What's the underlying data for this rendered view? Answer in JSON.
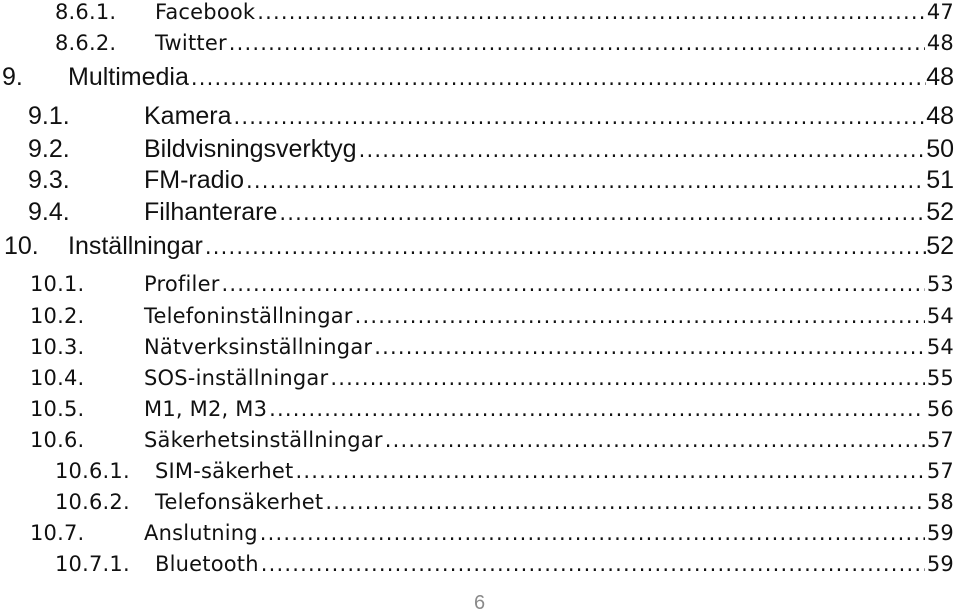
{
  "toc": {
    "entries": [
      {
        "number": "8.6.1.",
        "title": "Facebook",
        "page": "47",
        "level": 3
      },
      {
        "number": "8.6.2.",
        "title": "Twitter",
        "page": "48",
        "level": 3
      },
      {
        "number": "9.",
        "title": "Multimedia",
        "page": "48",
        "level": 1
      },
      {
        "number": "9.1.",
        "title": "Kamera",
        "page": "48",
        "level": 2
      },
      {
        "number": "9.2.",
        "title": "Bildvisningsverktyg",
        "page": "50",
        "level": 2
      },
      {
        "number": "9.3.",
        "title": "FM-radio",
        "page": "51",
        "level": 2
      },
      {
        "number": "9.4.",
        "title": "Filhanterare",
        "page": "52",
        "level": 2
      },
      {
        "number": "10.",
        "title": "Inställningar",
        "page": "52",
        "level": 1
      },
      {
        "number": "10.1.",
        "title": "Profiler",
        "page": "53",
        "level": 2
      },
      {
        "number": "10.2.",
        "title": "Telefoninställningar",
        "page": "54",
        "level": 2
      },
      {
        "number": "10.3.",
        "title": "Nätverksinställningar",
        "page": "54",
        "level": 2
      },
      {
        "number": "10.4.",
        "title": "SOS-inställningar",
        "page": "55",
        "level": 2
      },
      {
        "number": "10.5.",
        "title": "M1, M2, M3",
        "page": "56",
        "level": 2
      },
      {
        "number": "10.6.",
        "title": "Säkerhetsinställningar",
        "page": "57",
        "level": 2
      },
      {
        "number": "10.6.1.",
        "title": "SIM-säkerhet",
        "page": "57",
        "level": 3
      },
      {
        "number": "10.6.2.",
        "title": "Telefonsäkerhet",
        "page": "58",
        "level": 3
      },
      {
        "number": "10.7.",
        "title": "Anslutning",
        "page": "59",
        "level": 2
      },
      {
        "number": "10.7.1.",
        "title": "Bluetooth",
        "page": "59",
        "level": 3
      }
    ]
  },
  "footer": {
    "page_number": "6"
  }
}
